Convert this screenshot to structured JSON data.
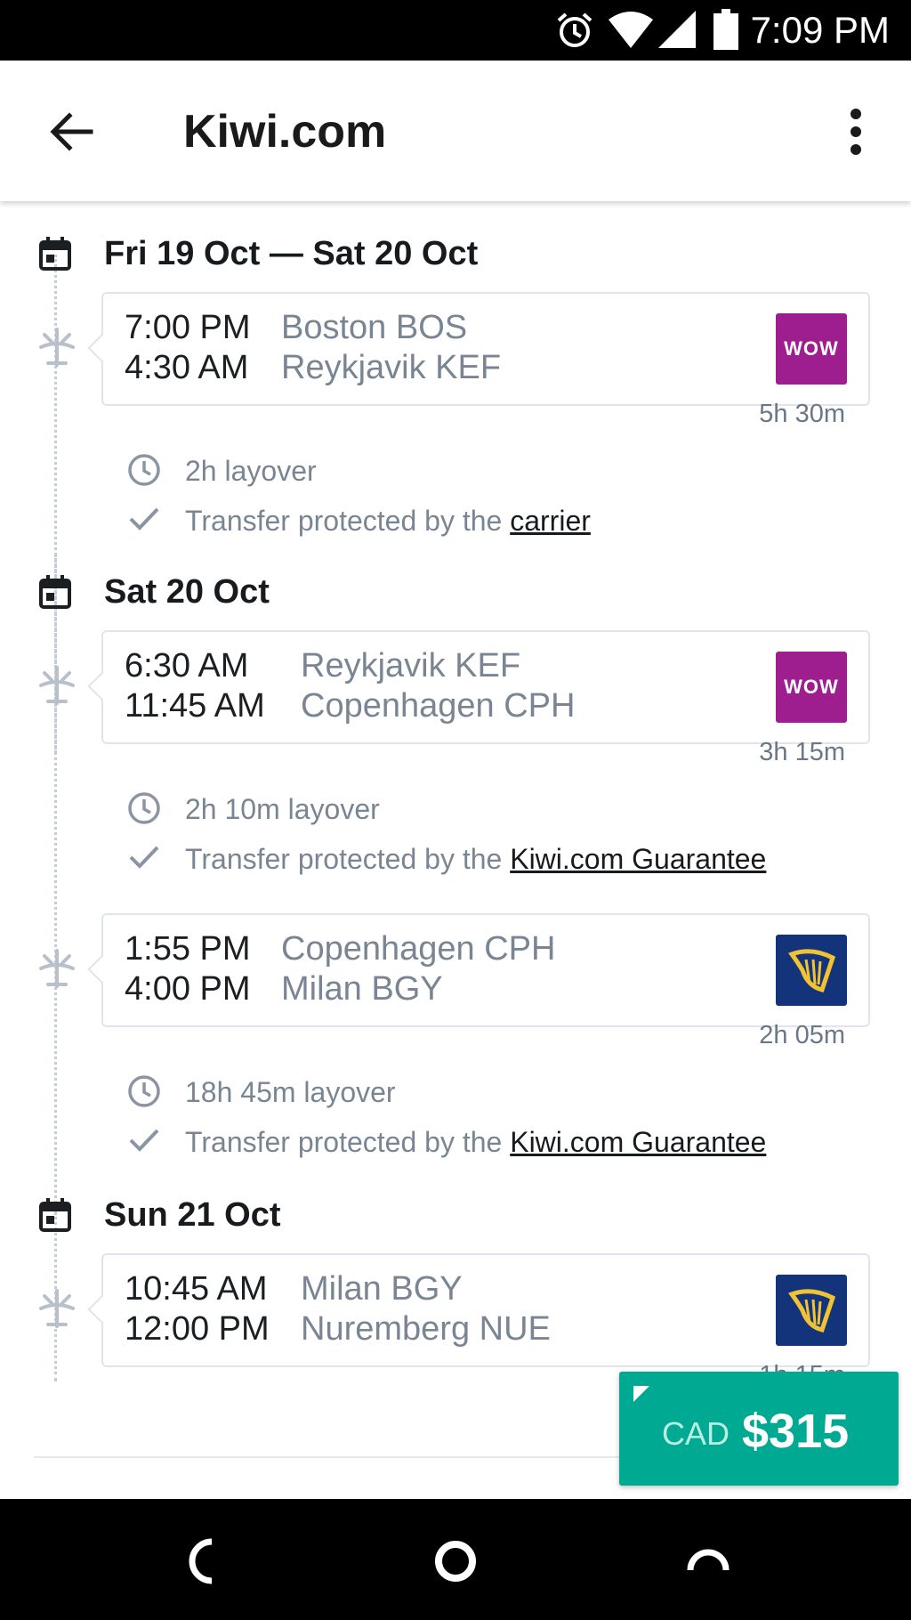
{
  "status_bar": {
    "time": "7:09 PM",
    "icons": [
      "alarm-icon",
      "wifi-icon",
      "signal-icon",
      "battery-icon"
    ]
  },
  "app_bar": {
    "title": "Kiwi.com",
    "back_icon": "arrow-back-icon",
    "menu_icon": "more-vert-icon"
  },
  "itinerary": {
    "dates": [
      {
        "label": "Fri 19 Oct — Sat 20 Oct"
      },
      {
        "label": "Sat 20 Oct"
      },
      {
        "label": "Sun 21 Oct"
      }
    ],
    "segments": [
      {
        "dep_time": "7:00 PM",
        "dep_place": "Boston BOS",
        "arr_time": "4:30 AM",
        "arr_place": "Reykjavik KEF",
        "carrier_logo": "WOW",
        "duration": "5h 30m"
      },
      {
        "dep_time": "6:30 AM",
        "dep_place": "Reykjavik KEF",
        "arr_time": "11:45 AM",
        "arr_place": "Copenhagen CPH",
        "carrier_logo": "WOW",
        "duration": "3h 15m"
      },
      {
        "dep_time": "1:55 PM",
        "dep_place": "Copenhagen CPH",
        "arr_time": "4:00 PM",
        "arr_place": "Milan BGY",
        "carrier_logo": "ryanair-harp",
        "duration": "2h 05m"
      },
      {
        "dep_time": "10:45 AM",
        "dep_place": "Milan BGY",
        "arr_time": "12:00 PM",
        "arr_place": "Nuremberg NUE",
        "carrier_logo": "ryanair-harp",
        "duration": "1h 15m"
      }
    ],
    "layovers": [
      {
        "duration": "2h layover",
        "protection_prefix": "Transfer protected by the ",
        "protection_link": "carrier"
      },
      {
        "duration": "2h 10m layover",
        "protection_prefix": "Transfer protected by the ",
        "protection_link": "Kiwi.com Guarantee"
      },
      {
        "duration": "18h 45m layover",
        "protection_prefix": "Transfer protected by the ",
        "protection_link": "Kiwi.com Guarantee"
      }
    ]
  },
  "price": {
    "currency": "CAD",
    "amount": "$315"
  },
  "colors": {
    "accent": "#00a991",
    "wow": "#9e1d8f",
    "ryanair": "#13347a",
    "muted_text": "#7a8593"
  },
  "nav_bar": {
    "icons": [
      "back-nav-icon",
      "home-nav-icon",
      "recents-nav-icon"
    ]
  }
}
